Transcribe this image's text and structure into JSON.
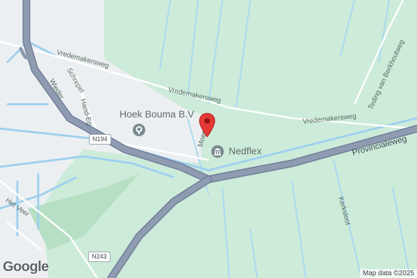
{
  "map": {
    "colors": {
      "land": "#cdebd9",
      "urban": "#eceff1",
      "water": "#9ed0f0",
      "highway": "#8f9bb1",
      "highway_edge": "#6f7d99",
      "road": "#ffffff",
      "pin": "#e53935"
    },
    "poi": [
      {
        "name": "Hoek Bouma B.V",
        "icon": "pin-circle-icon",
        "icon_color": "#7b8a8f"
      },
      {
        "name": "Nedflex",
        "icon": "building-icon",
        "icon_color": "#7b8a8f"
      }
    ],
    "road_labels": [
      {
        "text": "Vredemakersweg"
      },
      {
        "text": "Vredemakersweg"
      },
      {
        "text": "Vredemakersweg"
      },
      {
        "text": "Schrepel"
      },
      {
        "text": "Wieder"
      },
      {
        "text": "Hand-Eg"
      },
      {
        "text": "Moers"
      },
      {
        "text": "Provincialeweg"
      },
      {
        "text": "Teding van Berkhoutweg"
      },
      {
        "text": "Kerksloot"
      },
      {
        "text": "Het Veer"
      }
    ],
    "shields": [
      {
        "text": "N194"
      },
      {
        "text": "N243"
      }
    ],
    "marker": {
      "icon": "location-pin-icon"
    },
    "logo": "Google",
    "attribution": "Map data ©2025"
  }
}
